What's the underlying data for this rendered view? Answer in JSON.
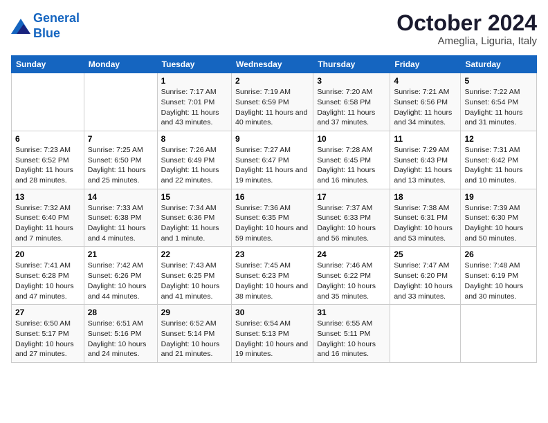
{
  "header": {
    "logo_line1": "General",
    "logo_line2": "Blue",
    "month": "October 2024",
    "location": "Ameglia, Liguria, Italy"
  },
  "weekdays": [
    "Sunday",
    "Monday",
    "Tuesday",
    "Wednesday",
    "Thursday",
    "Friday",
    "Saturday"
  ],
  "weeks": [
    [
      null,
      null,
      {
        "day": 1,
        "sunrise": "7:17 AM",
        "sunset": "7:01 PM",
        "daylight": "11 hours and 43 minutes."
      },
      {
        "day": 2,
        "sunrise": "7:19 AM",
        "sunset": "6:59 PM",
        "daylight": "11 hours and 40 minutes."
      },
      {
        "day": 3,
        "sunrise": "7:20 AM",
        "sunset": "6:58 PM",
        "daylight": "11 hours and 37 minutes."
      },
      {
        "day": 4,
        "sunrise": "7:21 AM",
        "sunset": "6:56 PM",
        "daylight": "11 hours and 34 minutes."
      },
      {
        "day": 5,
        "sunrise": "7:22 AM",
        "sunset": "6:54 PM",
        "daylight": "11 hours and 31 minutes."
      }
    ],
    [
      {
        "day": 6,
        "sunrise": "7:23 AM",
        "sunset": "6:52 PM",
        "daylight": "11 hours and 28 minutes."
      },
      {
        "day": 7,
        "sunrise": "7:25 AM",
        "sunset": "6:50 PM",
        "daylight": "11 hours and 25 minutes."
      },
      {
        "day": 8,
        "sunrise": "7:26 AM",
        "sunset": "6:49 PM",
        "daylight": "11 hours and 22 minutes."
      },
      {
        "day": 9,
        "sunrise": "7:27 AM",
        "sunset": "6:47 PM",
        "daylight": "11 hours and 19 minutes."
      },
      {
        "day": 10,
        "sunrise": "7:28 AM",
        "sunset": "6:45 PM",
        "daylight": "11 hours and 16 minutes."
      },
      {
        "day": 11,
        "sunrise": "7:29 AM",
        "sunset": "6:43 PM",
        "daylight": "11 hours and 13 minutes."
      },
      {
        "day": 12,
        "sunrise": "7:31 AM",
        "sunset": "6:42 PM",
        "daylight": "11 hours and 10 minutes."
      }
    ],
    [
      {
        "day": 13,
        "sunrise": "7:32 AM",
        "sunset": "6:40 PM",
        "daylight": "11 hours and 7 minutes."
      },
      {
        "day": 14,
        "sunrise": "7:33 AM",
        "sunset": "6:38 PM",
        "daylight": "11 hours and 4 minutes."
      },
      {
        "day": 15,
        "sunrise": "7:34 AM",
        "sunset": "6:36 PM",
        "daylight": "11 hours and 1 minute."
      },
      {
        "day": 16,
        "sunrise": "7:36 AM",
        "sunset": "6:35 PM",
        "daylight": "10 hours and 59 minutes."
      },
      {
        "day": 17,
        "sunrise": "7:37 AM",
        "sunset": "6:33 PM",
        "daylight": "10 hours and 56 minutes."
      },
      {
        "day": 18,
        "sunrise": "7:38 AM",
        "sunset": "6:31 PM",
        "daylight": "10 hours and 53 minutes."
      },
      {
        "day": 19,
        "sunrise": "7:39 AM",
        "sunset": "6:30 PM",
        "daylight": "10 hours and 50 minutes."
      }
    ],
    [
      {
        "day": 20,
        "sunrise": "7:41 AM",
        "sunset": "6:28 PM",
        "daylight": "10 hours and 47 minutes."
      },
      {
        "day": 21,
        "sunrise": "7:42 AM",
        "sunset": "6:26 PM",
        "daylight": "10 hours and 44 minutes."
      },
      {
        "day": 22,
        "sunrise": "7:43 AM",
        "sunset": "6:25 PM",
        "daylight": "10 hours and 41 minutes."
      },
      {
        "day": 23,
        "sunrise": "7:45 AM",
        "sunset": "6:23 PM",
        "daylight": "10 hours and 38 minutes."
      },
      {
        "day": 24,
        "sunrise": "7:46 AM",
        "sunset": "6:22 PM",
        "daylight": "10 hours and 35 minutes."
      },
      {
        "day": 25,
        "sunrise": "7:47 AM",
        "sunset": "6:20 PM",
        "daylight": "10 hours and 33 minutes."
      },
      {
        "day": 26,
        "sunrise": "7:48 AM",
        "sunset": "6:19 PM",
        "daylight": "10 hours and 30 minutes."
      }
    ],
    [
      {
        "day": 27,
        "sunrise": "6:50 AM",
        "sunset": "5:17 PM",
        "daylight": "10 hours and 27 minutes."
      },
      {
        "day": 28,
        "sunrise": "6:51 AM",
        "sunset": "5:16 PM",
        "daylight": "10 hours and 24 minutes."
      },
      {
        "day": 29,
        "sunrise": "6:52 AM",
        "sunset": "5:14 PM",
        "daylight": "10 hours and 21 minutes."
      },
      {
        "day": 30,
        "sunrise": "6:54 AM",
        "sunset": "5:13 PM",
        "daylight": "10 hours and 19 minutes."
      },
      {
        "day": 31,
        "sunrise": "6:55 AM",
        "sunset": "5:11 PM",
        "daylight": "10 hours and 16 minutes."
      },
      null,
      null
    ]
  ]
}
